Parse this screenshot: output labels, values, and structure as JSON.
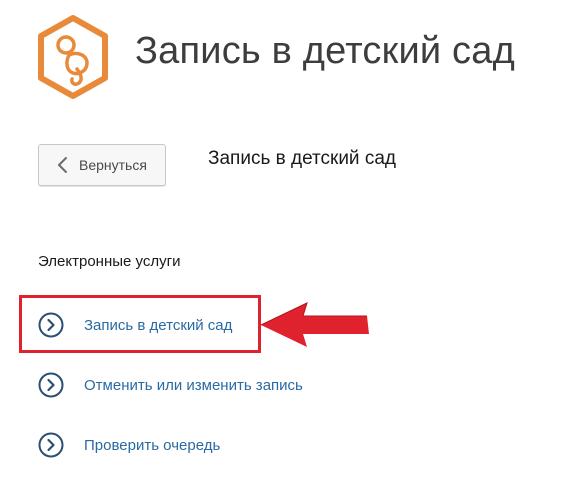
{
  "header": {
    "title": "Запись в детский сад",
    "logo_icon": "pacifier-hexagon-icon",
    "accent_color": "#e88a3a"
  },
  "toolbar": {
    "back_label": "Вернуться",
    "back_icon": "chevron-left-icon"
  },
  "main": {
    "section_title": "Запись в детский сад",
    "services_heading": "Электронные услуги",
    "services": [
      {
        "label": "Запись в детский сад",
        "icon": "chevron-right-circle-icon",
        "highlighted": true
      },
      {
        "label": "Отменить или изменить запись",
        "icon": "chevron-right-circle-icon",
        "highlighted": false
      },
      {
        "label": "Проверить очередь",
        "icon": "chevron-right-circle-icon",
        "highlighted": false
      }
    ],
    "link_color": "#2a6aa3",
    "highlight_color": "#e0222e"
  }
}
